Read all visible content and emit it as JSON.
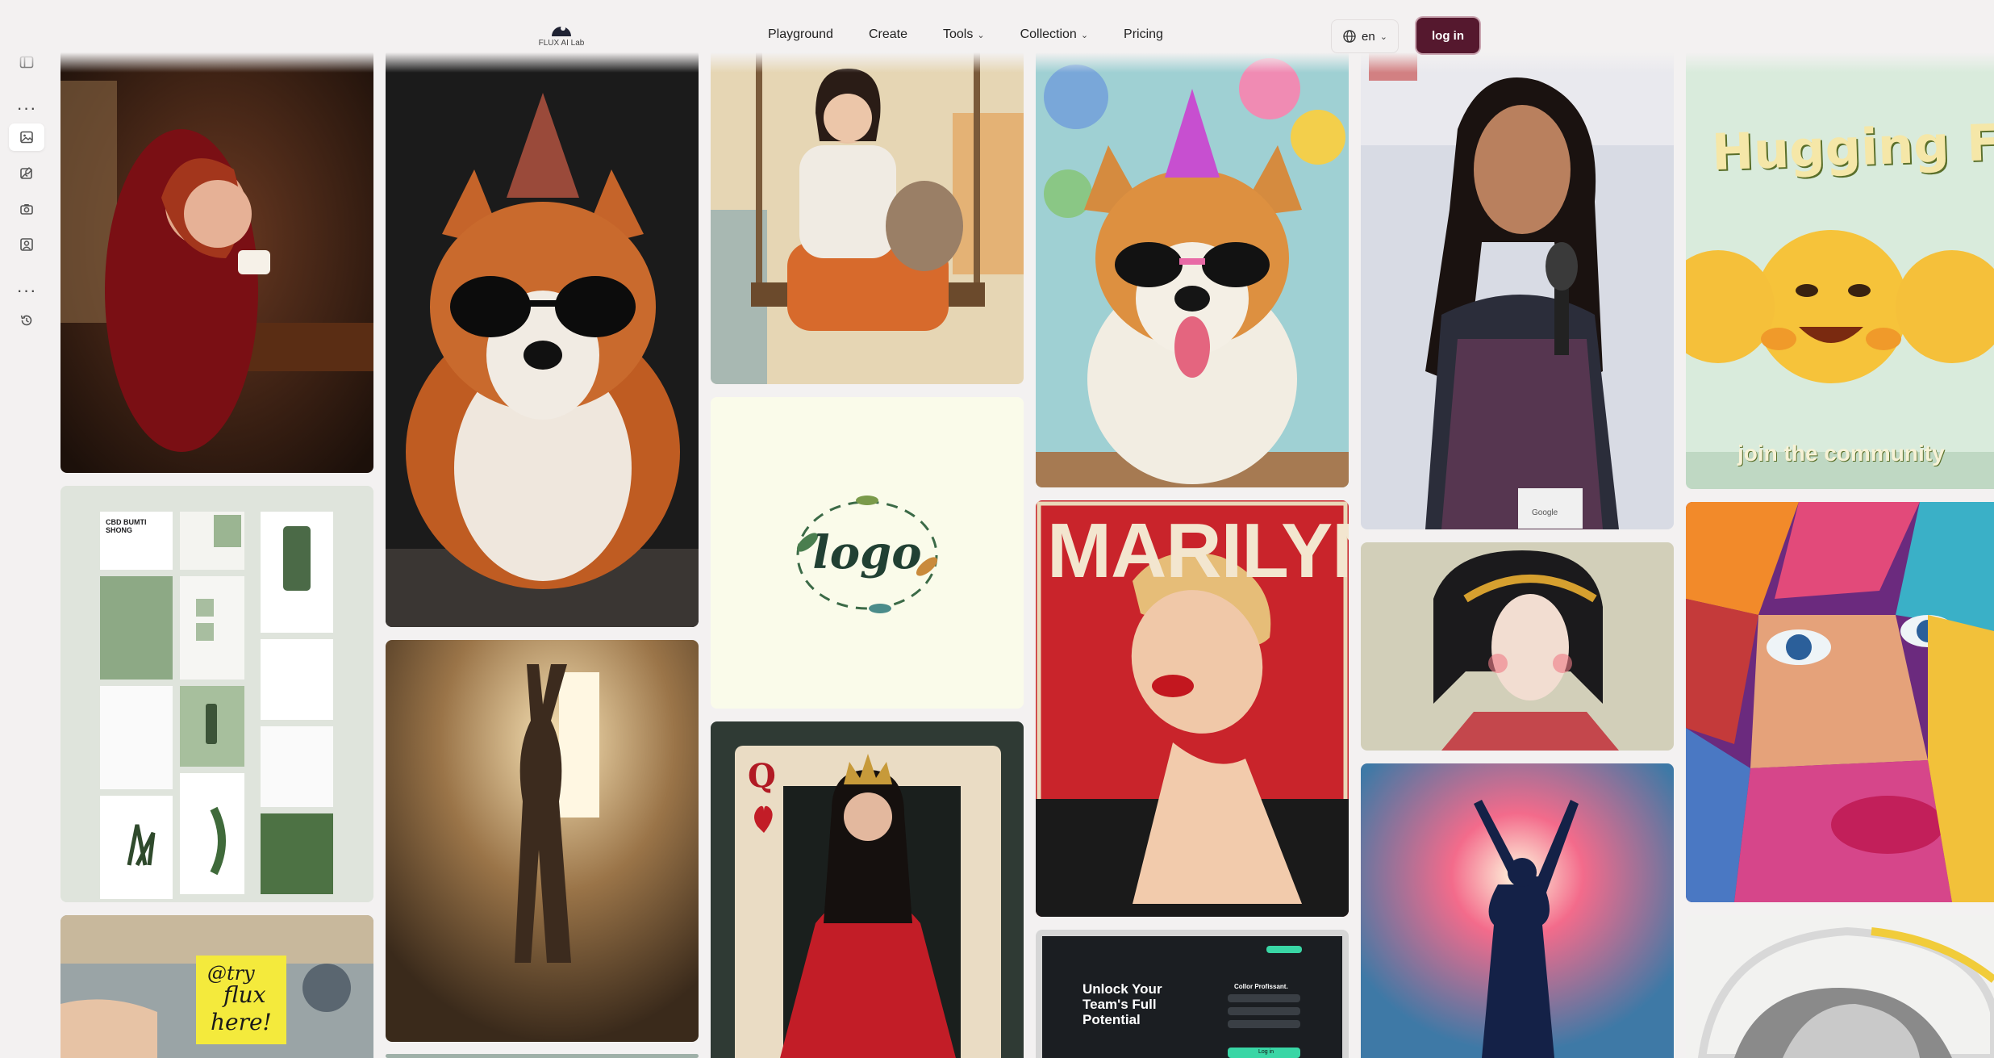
{
  "brand": {
    "name": "FLUX AI Lab"
  },
  "nav": {
    "items": [
      {
        "label": "Playground"
      },
      {
        "label": "Create"
      },
      {
        "label": "Tools"
      },
      {
        "label": "Collection"
      },
      {
        "label": "Pricing"
      }
    ],
    "language": "en",
    "login_label": "log in"
  },
  "sidebar": {
    "icons": [
      "sidebar-toggle-icon",
      "more-icon",
      "image-icon",
      "image-edit-icon",
      "camera-icon",
      "portrait-icon",
      "more-icon",
      "history-icon"
    ]
  },
  "gallery": {
    "logo_text": "logo",
    "marilyn_text": "MARILYN",
    "hugging_title": "Hugging Face",
    "hugging_sub": "join the community",
    "note_line1": "@try",
    "note_line2": "flux",
    "note_line3": "here!",
    "card_rank": "Q",
    "cbd_title": "CBD BUMTI SHONG",
    "web_headline": "Unlock Your Team's Full Potential",
    "web_form_title": "Collor Profissant.",
    "web_form_button": "Log in",
    "badge_text": "Google"
  },
  "colors": {
    "accent": "#55182e",
    "background": "#f3f1f1"
  }
}
